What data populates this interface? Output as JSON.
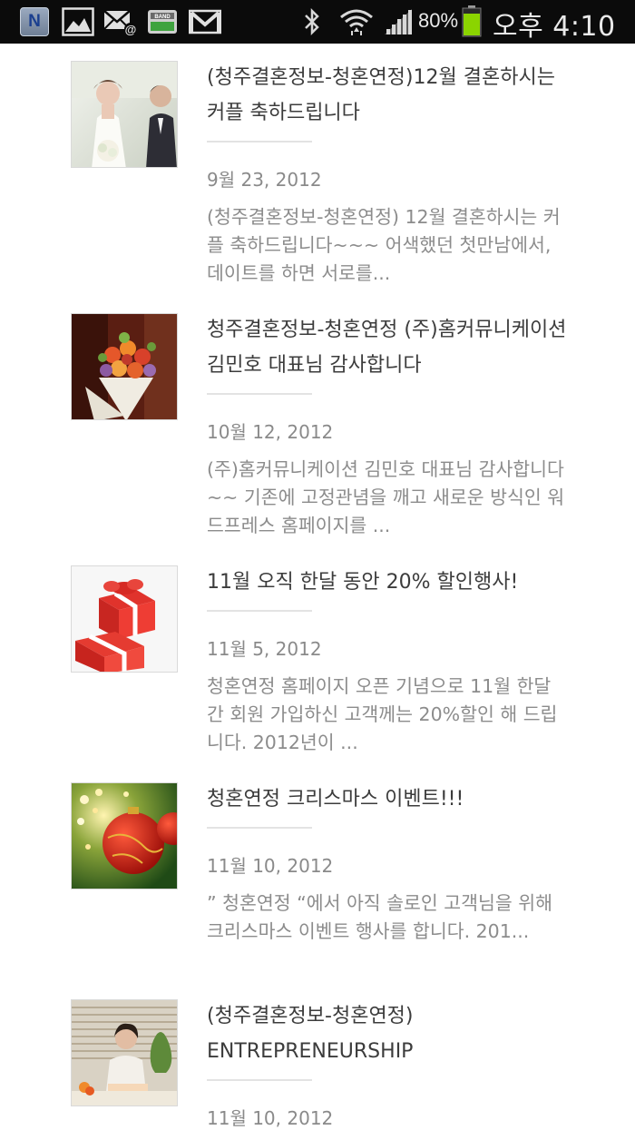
{
  "status_bar": {
    "battery_percent": "80%",
    "time": "오후 4:10",
    "notification_icons": [
      "naver-icon",
      "gallery-icon",
      "email-icon",
      "band-icon",
      "gmail-icon"
    ],
    "system_icons": [
      "bluetooth-icon",
      "wifi-icon",
      "signal-icon",
      "battery-icon"
    ],
    "battery_color": "#8bd400"
  },
  "posts": [
    {
      "title": "(청주결혼정보-청혼연정)12월 결혼하시는 커플 축하드립니다",
      "date": "9월 23, 2012",
      "excerpt": "(청주결혼정보-청혼연정) 12월 결혼하시는 커플 축하드립니다~~~ 어색했던 첫만남에서, 데이트를 하면 서로를...",
      "thumbnail": "wedding-couple-image"
    },
    {
      "title": "청주결혼정보-청혼연정 (주)홈커뮤니케이션 김민호 대표님 감사합니다",
      "date": "10월 12, 2012",
      "excerpt": "(주)홈커뮤니케이션 김민호 대표님 감사합니다~~ 기존에 고정관념을 깨고 새로운 방식인 워드프레스 홈페이지를 ...",
      "thumbnail": "flower-bouquet-image"
    },
    {
      "title": "11월 오직 한달 동안 20% 할인행사!",
      "date": "11월 5, 2012",
      "excerpt": "청혼연정 홈페이지 오픈 기념으로 11월 한달간 회원 가입하신 고객께는 20%할인 해 드립니다. 2012년이 ...",
      "thumbnail": "gift-boxes-image"
    },
    {
      "title": "청혼연정 크리스마스 이벤트!!!",
      "date": "11월 10, 2012",
      "excerpt": "” 청혼연정 “에서 아직 솔로인 고객님을 위해 크리스마스 이벤트 행사를 합니다. 201...",
      "thumbnail": "christmas-ornament-image"
    },
    {
      "title": "(청주결혼정보-청혼연정) ENTREPRENEURSHIP",
      "date": "11월 10, 2012",
      "excerpt": "",
      "thumbnail": "ceo-portrait-image"
    }
  ]
}
